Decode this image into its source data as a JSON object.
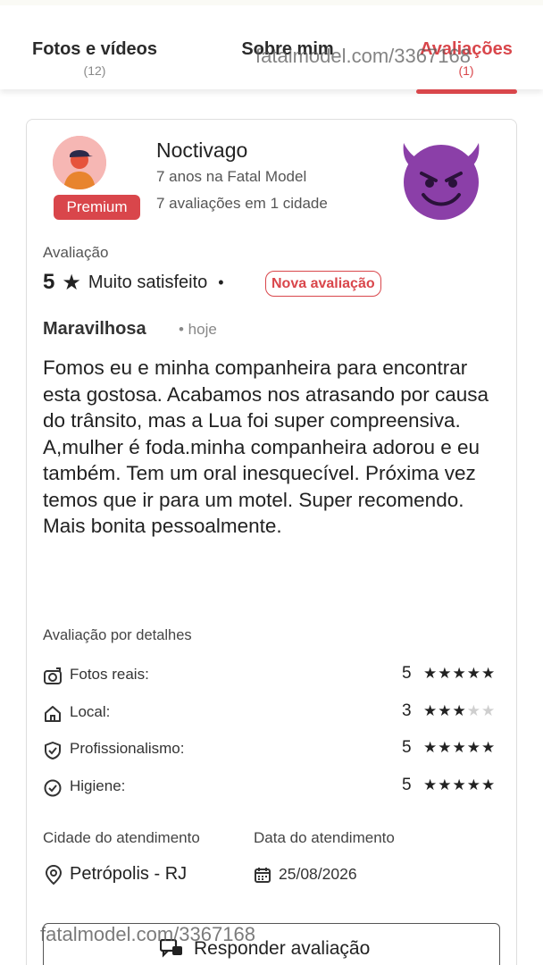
{
  "tabs": [
    {
      "label": "Fotos e vídeos",
      "count": "(12)"
    },
    {
      "label": "Sobre mim",
      "count": ""
    },
    {
      "label": "Avaliações",
      "count": "(1)"
    }
  ],
  "watermark": "fatalmodel.com/3367168",
  "reviewer": {
    "name": "Noctivago",
    "years": "7 anos na Fatal Model",
    "evaluations": "7 avaliações em 1 cidade",
    "badge": "Premium",
    "sticker": "smiling-devil-emoji"
  },
  "rating": {
    "label": "Avaliação",
    "score": "5",
    "star": "★",
    "text": "Muito satisfeito",
    "separator": "•",
    "badge": "Nova avaliação"
  },
  "review": {
    "title": "Maravilhosa",
    "when": "• hoje",
    "body": "Fomos eu e minha companheira para encontrar esta gostosa. Acabamos nos atrasando por causa do trânsito, mas a Lua foi super compreensiva. A,mulher é foda.minha companheira adorou e eu também. Tem um oral inesquecível. Próxima vez temos que ir para um motel. Super recomendo. Mais bonita pessoalmente."
  },
  "details": {
    "title": "Avaliação por detalhes",
    "items": [
      {
        "label": "Fotos reais:",
        "score": "5",
        "stars": 5,
        "icon": "camera-icon"
      },
      {
        "label": "Local:",
        "score": "3",
        "stars": 3,
        "icon": "home-icon"
      },
      {
        "label": "Profissionalismo:",
        "score": "5",
        "stars": 5,
        "icon": "shield-check-icon"
      },
      {
        "label": "Higiene:",
        "score": "5",
        "stars": 5,
        "icon": "check-circle-icon"
      }
    ]
  },
  "attendance": {
    "city_label": "Cidade do atendimento",
    "city_value": "Petrópolis - RJ",
    "date_label": "Data do atendimento",
    "date_value": "25/08/2026"
  },
  "reply_button": {
    "label": "Responder avaliação"
  },
  "colors": {
    "accent": "#d9464b",
    "devil": "#8b3fa8"
  }
}
